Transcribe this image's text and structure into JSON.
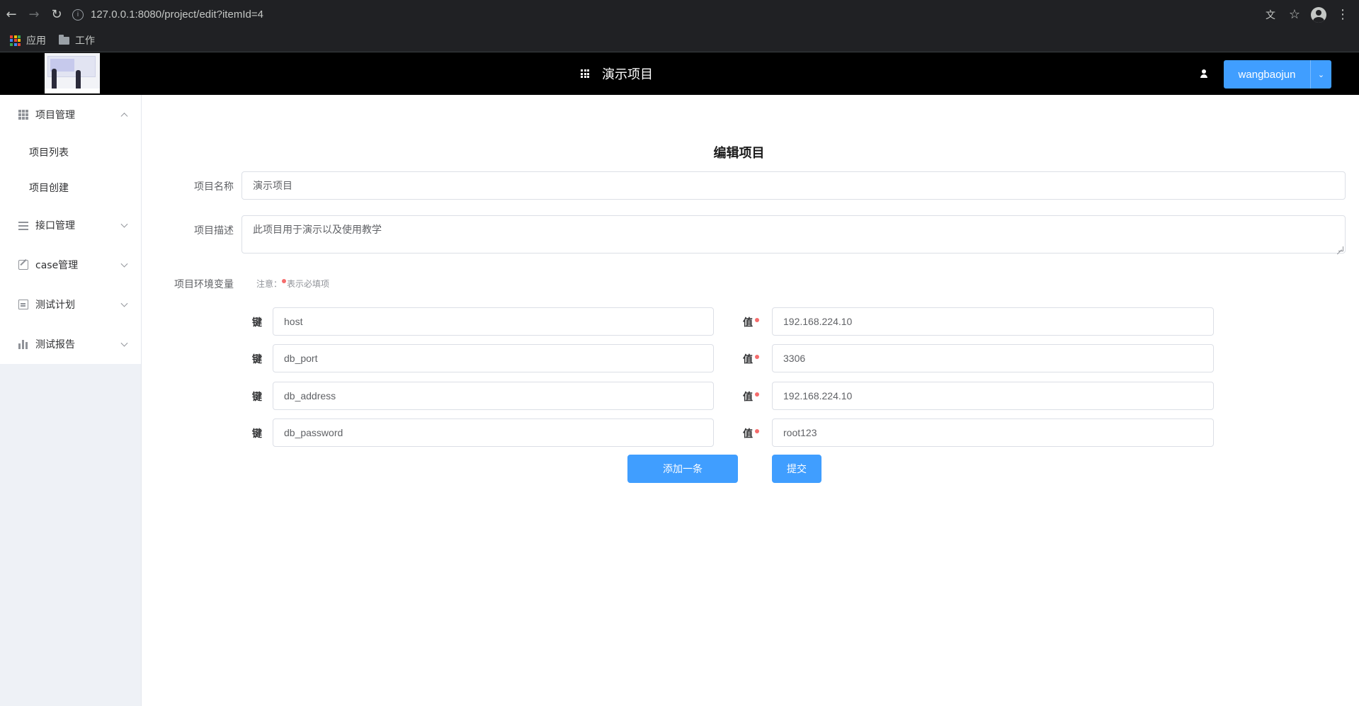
{
  "browser": {
    "url": "127.0.0.1:8080/project/edit?itemId=4",
    "bookmarks": [
      {
        "label": "应用"
      },
      {
        "label": "工作"
      }
    ]
  },
  "header": {
    "title": "演示项目",
    "username": "wangbaojun"
  },
  "sidebar": {
    "menus": [
      {
        "label": "项目管理",
        "expanded": true,
        "icon": "grid-icon",
        "children": [
          {
            "label": "项目列表"
          },
          {
            "label": "项目创建"
          }
        ]
      },
      {
        "label": "接口管理",
        "expanded": false,
        "icon": "list-icon"
      },
      {
        "label": "case管理",
        "expanded": false,
        "icon": "edit-icon"
      },
      {
        "label": "测试计划",
        "expanded": false,
        "icon": "document-icon"
      },
      {
        "label": "测试报告",
        "expanded": false,
        "icon": "bar-chart-icon"
      }
    ]
  },
  "form": {
    "title": "编辑项目",
    "name_label": "项目名称",
    "name_value": "演示项目",
    "desc_label": "项目描述",
    "desc_value": "此项目用于演示以及使用教学",
    "env_label": "项目环境变量",
    "note_prefix": "注意：",
    "note_text": "表示必填项",
    "key_label": "键",
    "value_label": "值",
    "env_vars": [
      {
        "key": "host",
        "value": "192.168.224.10"
      },
      {
        "key": "db_port",
        "value": "3306"
      },
      {
        "key": "db_address",
        "value": "192.168.224.10"
      },
      {
        "key": "db_password",
        "value": "root123"
      }
    ],
    "add_button": "添加一条",
    "submit_button": "提交"
  },
  "colors": {
    "primary": "#409eff",
    "required": "#f56c6c",
    "header_bg": "#000000",
    "sidebar_bg": "#eef1f6"
  }
}
